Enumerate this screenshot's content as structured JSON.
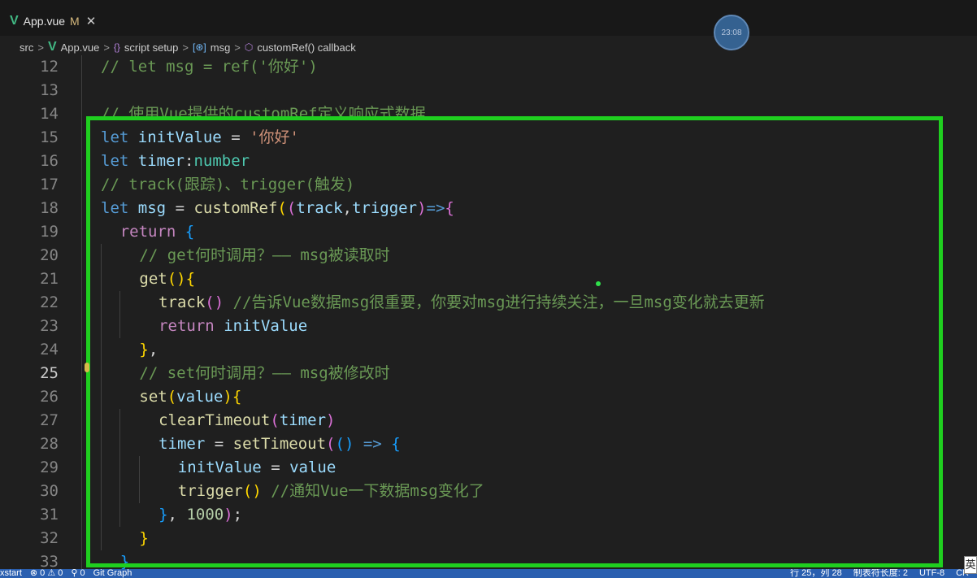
{
  "tab": {
    "icon": "vue-icon",
    "label": "App.vue",
    "modified": "M",
    "close": "✕"
  },
  "timer_badge": "23:08",
  "breadcrumb": {
    "items": [
      "src",
      "App.vue",
      "script setup",
      "msg",
      "customRef() callback"
    ],
    "sep": ">",
    "icons": [
      "vue-icon",
      "braces-icon",
      "variable-icon",
      "cube-icon"
    ],
    "glyphs": {
      "braces": "{}",
      "variable": "[⊛]",
      "cube": "⬡"
    }
  },
  "editor": {
    "active_line": 25,
    "lines": [
      {
        "n": "12",
        "text": "// let msg = ref('你好')"
      },
      {
        "n": "13",
        "text": ""
      },
      {
        "n": "14",
        "text": "// 使用Vue提供的customRef定义响应式数据"
      },
      {
        "n": "15",
        "text": "let initValue = '你好'"
      },
      {
        "n": "16",
        "text": "let timer:number"
      },
      {
        "n": "17",
        "text": "// track(跟踪)、trigger(触发)"
      },
      {
        "n": "18",
        "text": "let msg = customRef((track,trigger)=>{"
      },
      {
        "n": "19",
        "text": "return {"
      },
      {
        "n": "20",
        "text": "// get何时调用？—— msg被读取时"
      },
      {
        "n": "21",
        "text": "get(){"
      },
      {
        "n": "22",
        "text": "track() //告诉Vue数据msg很重要，你要对msg进行持续关注，一旦msg变化就去更新"
      },
      {
        "n": "23",
        "text": "return initValue"
      },
      {
        "n": "24",
        "text": "},"
      },
      {
        "n": "25",
        "text": "// set何时调用？—— msg被修改时"
      },
      {
        "n": "26",
        "text": "set(value){"
      },
      {
        "n": "27",
        "text": "clearTimeout(timer)"
      },
      {
        "n": "28",
        "text": "timer = setTimeout(() => {"
      },
      {
        "n": "29",
        "text": "initValue = value"
      },
      {
        "n": "30",
        "text": "trigger() //通知Vue一下数据msg变化了"
      },
      {
        "n": "31",
        "text": "}, 1000);"
      },
      {
        "n": "32",
        "text": "}"
      },
      {
        "n": "33",
        "text": "}"
      }
    ]
  },
  "statusbar": {
    "left": [
      "xstart",
      "⊗ 0 ⚠ 0",
      "⚲ 0",
      "Git Graph"
    ],
    "right": [
      "行 25，列 28",
      "制表符长度: 2",
      "UTF-8",
      "CR"
    ]
  },
  "ime_indicator": "英",
  "colors": {
    "highlight_box": "#1fcf1f",
    "statusbar": "#2a5fb0"
  }
}
